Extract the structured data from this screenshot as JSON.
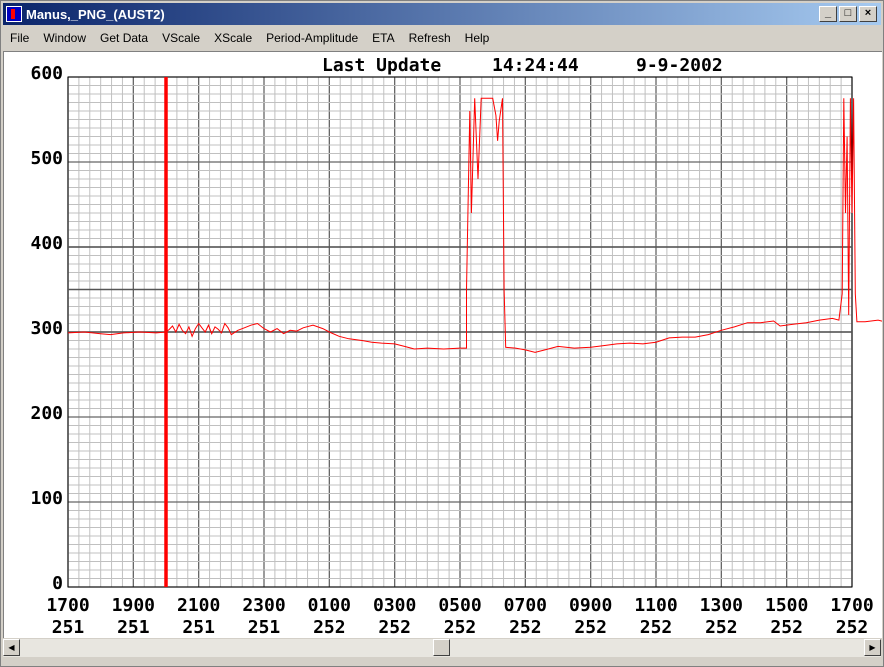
{
  "window": {
    "title": "Manus,_PNG_(AUST2)",
    "buttons": {
      "minimize": "_",
      "maximize": "□",
      "close": "×"
    }
  },
  "menu": [
    "File",
    "Window",
    "Get Data",
    "VScale",
    "XScale",
    "Period-Amplitude",
    "ETA",
    "Refresh",
    "Help"
  ],
  "header": {
    "label": "Last Update",
    "time": "14:24:44",
    "date": "9-9-2002"
  },
  "chart_data": {
    "type": "line",
    "ylim": [
      0,
      600
    ],
    "y_ticks": [
      0,
      100,
      200,
      300,
      400,
      500,
      600
    ],
    "xlim": [
      0,
      24
    ],
    "x_ticks": [
      {
        "time": "1700",
        "day": "251"
      },
      {
        "time": "1900",
        "day": "251"
      },
      {
        "time": "2100",
        "day": "251"
      },
      {
        "time": "2300",
        "day": "251"
      },
      {
        "time": "0100",
        "day": "252"
      },
      {
        "time": "0300",
        "day": "252"
      },
      {
        "time": "0500",
        "day": "252"
      },
      {
        "time": "0700",
        "day": "252"
      },
      {
        "time": "0900",
        "day": "252"
      },
      {
        "time": "1100",
        "day": "252"
      },
      {
        "time": "1300",
        "day": "252"
      },
      {
        "time": "1500",
        "day": "252"
      },
      {
        "time": "1700",
        "day": "252"
      }
    ],
    "marker_x": 3,
    "reference_lines": [
      300,
      350,
      400
    ],
    "series": [
      {
        "color": "#ff0000",
        "points": [
          [
            0,
            299
          ],
          [
            0.5,
            300
          ],
          [
            1,
            298
          ],
          [
            1.3,
            297
          ],
          [
            1.7,
            299
          ],
          [
            2.2,
            300
          ],
          [
            2.7,
            299
          ],
          [
            3.0,
            300
          ],
          [
            3.1,
            303
          ],
          [
            3.2,
            307
          ],
          [
            3.3,
            300
          ],
          [
            3.4,
            309
          ],
          [
            3.5,
            302
          ],
          [
            3.6,
            298
          ],
          [
            3.7,
            306
          ],
          [
            3.8,
            295
          ],
          [
            3.9,
            304
          ],
          [
            4.0,
            310
          ],
          [
            4.1,
            305
          ],
          [
            4.2,
            300
          ],
          [
            4.3,
            308
          ],
          [
            4.4,
            298
          ],
          [
            4.5,
            306
          ],
          [
            4.6,
            303
          ],
          [
            4.7,
            299
          ],
          [
            4.8,
            310
          ],
          [
            4.9,
            305
          ],
          [
            5.0,
            297
          ],
          [
            5.2,
            302
          ],
          [
            5.4,
            305
          ],
          [
            5.6,
            308
          ],
          [
            5.8,
            310
          ],
          [
            6.0,
            304
          ],
          [
            6.2,
            300
          ],
          [
            6.4,
            304
          ],
          [
            6.6,
            298
          ],
          [
            6.8,
            302
          ],
          [
            7.0,
            301
          ],
          [
            7.2,
            305
          ],
          [
            7.5,
            308
          ],
          [
            7.8,
            304
          ],
          [
            8.0,
            300
          ],
          [
            8.3,
            295
          ],
          [
            8.6,
            292
          ],
          [
            9.0,
            290
          ],
          [
            9.3,
            288
          ],
          [
            9.6,
            287
          ],
          [
            10.0,
            286
          ],
          [
            10.3,
            283
          ],
          [
            10.6,
            280
          ],
          [
            11.0,
            281
          ],
          [
            11.5,
            280
          ],
          [
            12.0,
            281
          ],
          [
            12.2,
            281
          ],
          [
            12.2,
            350
          ],
          [
            12.3,
            560
          ],
          [
            12.35,
            440
          ],
          [
            12.45,
            575
          ],
          [
            12.55,
            480
          ],
          [
            12.65,
            575
          ],
          [
            13.0,
            575
          ],
          [
            13.1,
            555
          ],
          [
            13.15,
            525
          ],
          [
            13.2,
            548
          ],
          [
            13.3,
            575
          ],
          [
            13.35,
            350
          ],
          [
            13.4,
            282
          ],
          [
            13.7,
            281
          ],
          [
            14.0,
            279
          ],
          [
            14.3,
            276
          ],
          [
            14.6,
            279
          ],
          [
            15.0,
            283
          ],
          [
            15.5,
            281
          ],
          [
            16.0,
            282
          ],
          [
            16.4,
            284
          ],
          [
            16.8,
            286
          ],
          [
            17.2,
            287
          ],
          [
            17.6,
            286
          ],
          [
            18.0,
            288
          ],
          [
            18.4,
            293
          ],
          [
            18.8,
            294
          ],
          [
            19.2,
            294
          ],
          [
            19.6,
            297
          ],
          [
            20.0,
            302
          ],
          [
            20.4,
            306
          ],
          [
            20.8,
            311
          ],
          [
            21.2,
            311
          ],
          [
            21.6,
            313
          ],
          [
            21.8,
            307
          ],
          [
            22.2,
            309
          ],
          [
            22.6,
            311
          ],
          [
            23.0,
            314
          ],
          [
            23.4,
            316
          ],
          [
            23.6,
            314
          ],
          [
            23.7,
            345
          ],
          [
            23.75,
            575
          ],
          [
            23.8,
            440
          ],
          [
            23.85,
            530
          ],
          [
            23.9,
            320
          ],
          [
            23.95,
            575
          ],
          [
            24.0,
            440
          ],
          [
            24.05,
            575
          ],
          [
            24.1,
            345
          ],
          [
            24.15,
            312
          ],
          [
            24.4,
            312
          ],
          [
            24.8,
            314
          ],
          [
            25.0,
            312
          ],
          [
            25.4,
            310
          ],
          [
            25.8,
            308
          ],
          [
            26.1,
            302
          ],
          [
            26.4,
            303
          ],
          [
            26.6,
            307
          ]
        ]
      }
    ]
  }
}
